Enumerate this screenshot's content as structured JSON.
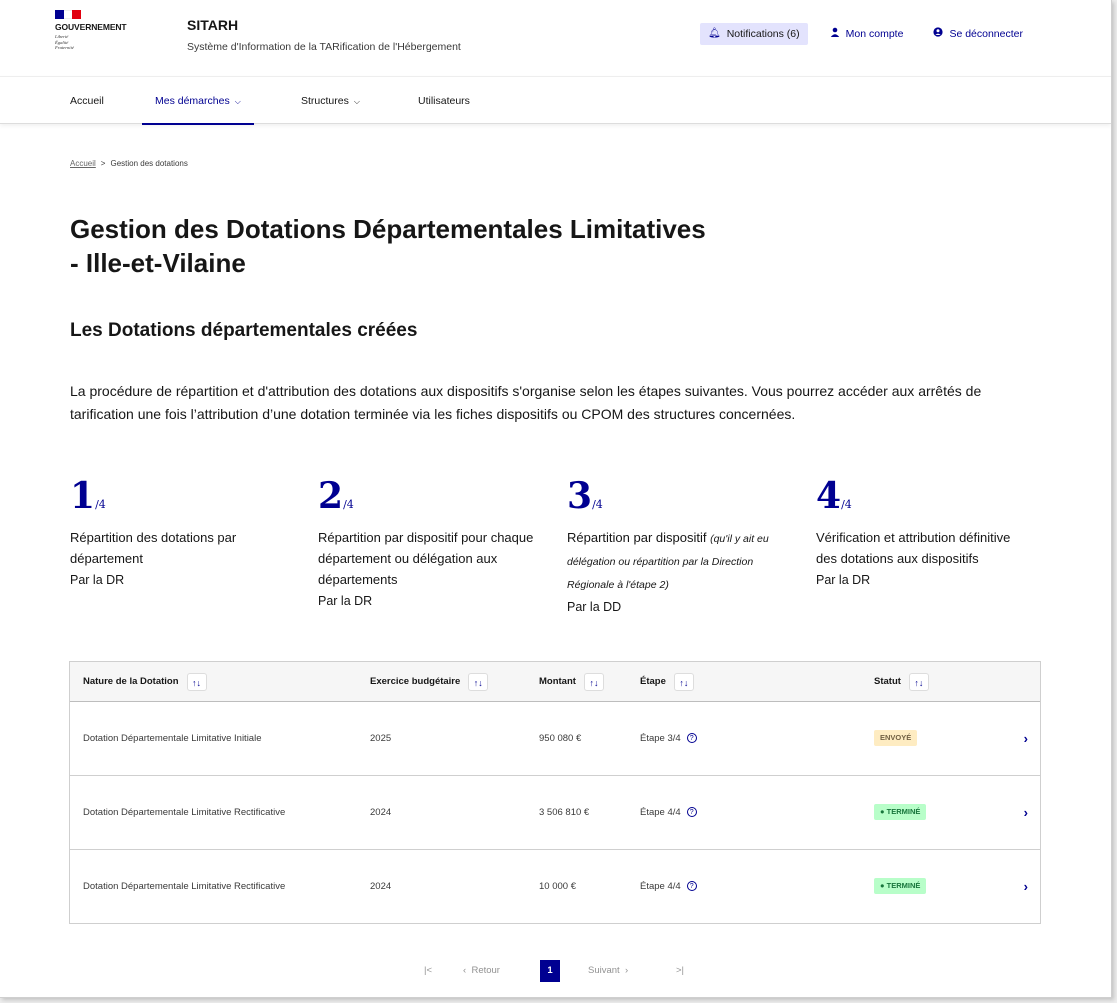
{
  "header": {
    "gov_name": "GOUVERNEMENT",
    "motto": [
      "Liberté",
      "Égalité",
      "Fraternité"
    ],
    "service_name": "SITARH",
    "service_tagline": "Système d'Information de la TARification de l'Hébergement",
    "notifications_label": "Notifications (6)",
    "account_label": "Mon compte",
    "logout_label": "Se déconnecter"
  },
  "nav": {
    "items": [
      {
        "label": "Accueil"
      },
      {
        "label": "Mes démarches",
        "active": true
      },
      {
        "label": "Structures"
      },
      {
        "label": "Utilisateurs"
      }
    ]
  },
  "breadcrumb": {
    "home": "Accueil",
    "separator": ">",
    "current": "Gestion des dotations"
  },
  "page": {
    "title_line1": "Gestion des Dotations Départementales Limitatives",
    "title_line2": "- Ille-et-Vilaine",
    "section_title": "Les Dotations départementales créées",
    "intro": "La procédure de répartition et d'attribution des dotations aux dispositifs s'organise selon les étapes suivantes. Vous pourrez accéder aux arrêtés de tarification une fois l’attribution d’une dotation terminée via les fiches dispositifs ou CPOM des structures concernées."
  },
  "steps": [
    {
      "num": "1",
      "of": "/4",
      "text": "Répartition des dotations par département",
      "by": "Par la DR"
    },
    {
      "num": "2",
      "of": "/4",
      "text": "Répartition par dispositif pour chaque département ou délégation aux départements",
      "by": "Par la DR"
    },
    {
      "num": "3",
      "of": "/4",
      "text": "Répartition par dispositif",
      "note": "(qu'il y ait eu délégation ou répartition par la Direction Régionale à l'étape 2)",
      "by": "Par la DD"
    },
    {
      "num": "4",
      "of": "/4",
      "text": "Vérification et attribution définitive des dotations aux dispositifs",
      "by": "Par la DR"
    }
  ],
  "table": {
    "columns": [
      "Nature de la Dotation",
      "Exercice budgétaire",
      "Montant",
      "Étape",
      "Statut"
    ],
    "sort_icon": "↑↓",
    "rows": [
      {
        "nature": "Dotation Départementale Limitative Initiale",
        "exercice": "2025",
        "montant": "950 080 €",
        "etape": "Étape 3/4",
        "statut": "ENVOYÉ",
        "statut_kind": "envoye"
      },
      {
        "nature": "Dotation Départementale Limitative Rectificative",
        "exercice": "2024",
        "montant": "3 506 810 €",
        "etape": "Étape 4/4",
        "statut": "TERMINÉ",
        "statut_kind": "termine"
      },
      {
        "nature": "Dotation Départementale Limitative Rectificative",
        "exercice": "2024",
        "montant": "10 000 €",
        "etape": "Étape 4/4",
        "statut": "TERMINÉ",
        "statut_kind": "termine"
      }
    ]
  },
  "pagination": {
    "first": "|<",
    "prev": "Retour",
    "current": "1",
    "next": "Suivant",
    "last": ">|"
  },
  "colors": {
    "primary": "#000091",
    "flag_blue": "#000091",
    "flag_white": "#ffffff",
    "flag_red": "#e1000f"
  }
}
